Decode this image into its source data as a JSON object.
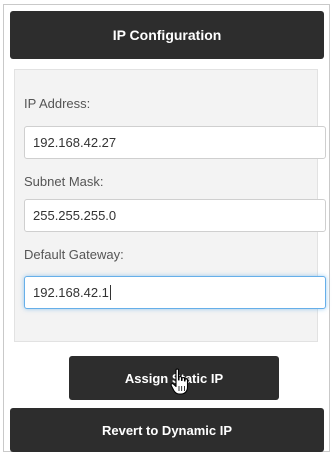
{
  "header": {
    "title": "IP Configuration"
  },
  "form": {
    "ip_label": "IP Address:",
    "ip_value": "192.168.42.27",
    "subnet_label": "Subnet Mask:",
    "subnet_value": "255.255.255.0",
    "gateway_label": "Default Gateway:",
    "gateway_value": "192.168.42.1"
  },
  "buttons": {
    "assign_label": "Assign Static IP",
    "revert_label": "Revert to Dynamic IP"
  },
  "icons": {
    "pointer": "hand-pointer-icon"
  },
  "colors": {
    "dark": "#2d2d2d",
    "panel": "#f3f3f3",
    "focus": "#66afe9"
  }
}
